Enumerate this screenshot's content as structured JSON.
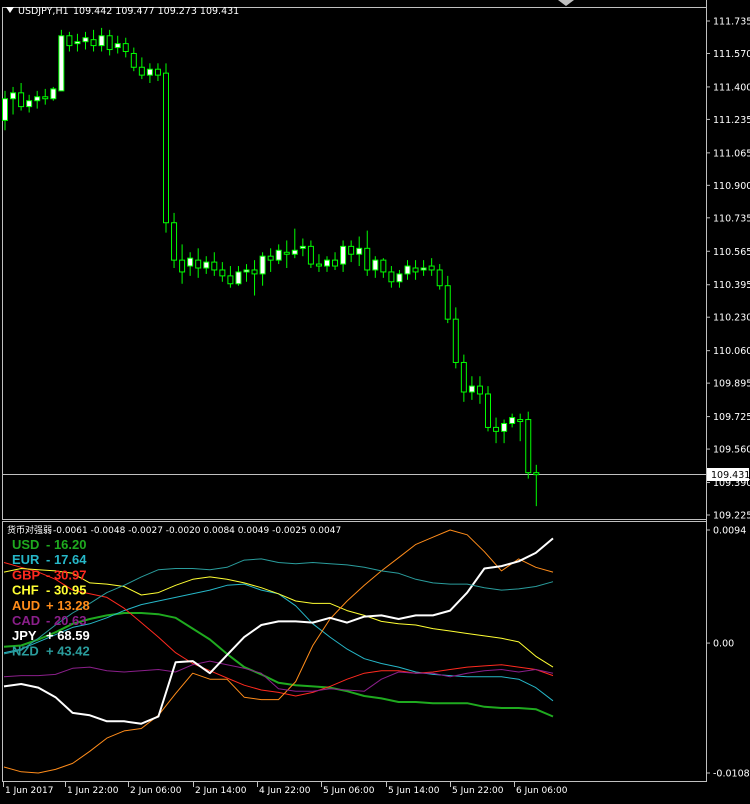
{
  "header": {
    "symbol_tf": "USDJPY,H1",
    "ohlc": "109.442 109.477 109.273 109.431"
  },
  "indicator": {
    "name": "货币对强弱",
    "values": "-0.0061 -0.0048 -0.0027 -0.0020 0.0084 0.0049 -0.0025 0.0047"
  },
  "current_price": "109.431",
  "colors": {
    "background": "#000000",
    "candle": "#00ff00",
    "bull_body": "#ffffff",
    "grid_frame": "#c0c0c0",
    "USD": "#1faa1f",
    "EUR": "#26b7c8",
    "GBP": "#ff2a1f",
    "CHF": "#ffff33",
    "AUD": "#ff8c1a",
    "CAD": "#8b1f8b",
    "JPY": "#ffffff",
    "NZD": "#2a9d9d"
  },
  "chart_data": [
    {
      "type": "candlestick",
      "title": "USDJPY,H1",
      "y_ticks": [
        "111.735",
        "111.570",
        "111.400",
        "111.235",
        "111.065",
        "110.900",
        "110.735",
        "110.565",
        "110.395",
        "110.230",
        "110.060",
        "109.895",
        "109.725",
        "109.560",
        "109.390",
        "109.225"
      ],
      "ylim": [
        109.225,
        111.735
      ],
      "x_ticks": [
        "1 Jun 2017",
        "1 Jun 22:00",
        "2 Jun 06:00",
        "2 Jun 14:00",
        "4 Jun 22:00",
        "5 Jun 06:00",
        "5 Jun 14:00",
        "5 Jun 22:00",
        "6 Jun 06:00"
      ],
      "candles": [
        [
          111.23,
          111.38,
          111.18,
          111.34
        ],
        [
          111.34,
          111.4,
          111.26,
          111.37
        ],
        [
          111.37,
          111.42,
          111.28,
          111.3
        ],
        [
          111.3,
          111.36,
          111.27,
          111.33
        ],
        [
          111.33,
          111.38,
          111.29,
          111.35
        ],
        [
          111.35,
          111.39,
          111.31,
          111.34
        ],
        [
          111.34,
          111.4,
          111.33,
          111.39
        ],
        [
          111.38,
          111.69,
          111.38,
          111.66
        ],
        [
          111.66,
          111.68,
          111.58,
          111.61
        ],
        [
          111.62,
          111.67,
          111.58,
          111.63
        ],
        [
          111.63,
          111.68,
          111.59,
          111.65
        ],
        [
          111.64,
          111.69,
          111.58,
          111.61
        ],
        [
          111.61,
          111.7,
          111.58,
          111.66
        ],
        [
          111.66,
          111.69,
          111.56,
          111.59
        ],
        [
          111.6,
          111.66,
          111.57,
          111.62
        ],
        [
          111.62,
          111.65,
          111.55,
          111.58
        ],
        [
          111.57,
          111.6,
          111.48,
          111.5
        ],
        [
          111.5,
          111.55,
          111.44,
          111.46
        ],
        [
          111.46,
          111.52,
          111.42,
          111.49
        ],
        [
          111.49,
          111.52,
          111.43,
          111.46
        ],
        [
          111.47,
          111.52,
          110.66,
          110.71
        ],
        [
          110.71,
          110.76,
          110.48,
          110.52
        ],
        [
          110.52,
          110.6,
          110.4,
          110.46
        ],
        [
          110.49,
          110.56,
          110.44,
          110.53
        ],
        [
          110.52,
          110.58,
          110.43,
          110.48
        ],
        [
          110.48,
          110.54,
          110.45,
          110.51
        ],
        [
          110.51,
          110.56,
          110.44,
          110.47
        ],
        [
          110.47,
          110.51,
          110.41,
          110.44
        ],
        [
          110.44,
          110.49,
          110.38,
          110.4
        ],
        [
          110.4,
          110.49,
          110.39,
          110.46
        ],
        [
          110.46,
          110.5,
          110.41,
          110.47
        ],
        [
          110.47,
          110.52,
          110.34,
          110.45
        ],
        [
          110.45,
          110.56,
          110.39,
          110.54
        ],
        [
          110.54,
          110.58,
          110.46,
          110.52
        ],
        [
          110.52,
          110.6,
          110.5,
          110.57
        ],
        [
          110.56,
          110.62,
          110.48,
          110.55
        ],
        [
          110.55,
          110.68,
          110.53,
          110.57
        ],
        [
          110.58,
          110.63,
          110.54,
          110.59
        ],
        [
          110.59,
          110.62,
          110.48,
          110.5
        ],
        [
          110.5,
          110.55,
          110.46,
          110.49
        ],
        [
          110.49,
          110.54,
          110.46,
          110.52
        ],
        [
          110.52,
          110.56,
          110.47,
          110.49
        ],
        [
          110.5,
          110.62,
          110.46,
          110.59
        ],
        [
          110.59,
          110.62,
          110.51,
          110.55
        ],
        [
          110.55,
          110.64,
          110.49,
          110.58
        ],
        [
          110.58,
          110.67,
          110.44,
          110.47
        ],
        [
          110.47,
          110.54,
          110.43,
          110.52
        ],
        [
          110.52,
          110.53,
          110.43,
          110.46
        ],
        [
          110.46,
          110.49,
          110.38,
          110.41
        ],
        [
          110.41,
          110.47,
          110.38,
          110.45
        ],
        [
          110.45,
          110.52,
          110.42,
          110.49
        ],
        [
          110.48,
          110.52,
          110.42,
          110.46
        ],
        [
          110.47,
          110.52,
          110.44,
          110.48
        ],
        [
          110.49,
          110.53,
          110.44,
          110.47
        ],
        [
          110.47,
          110.5,
          110.37,
          110.39
        ],
        [
          110.39,
          110.44,
          110.2,
          110.22
        ],
        [
          110.22,
          110.28,
          109.97,
          110.0
        ],
        [
          110.0,
          110.04,
          109.8,
          109.85
        ],
        [
          109.85,
          109.93,
          109.81,
          109.88
        ],
        [
          109.88,
          109.93,
          109.79,
          109.84
        ],
        [
          109.84,
          109.88,
          109.65,
          109.67
        ],
        [
          109.67,
          109.72,
          109.59,
          109.65
        ],
        [
          109.65,
          109.71,
          109.59,
          109.69
        ],
        [
          109.69,
          109.74,
          109.67,
          109.72
        ],
        [
          109.71,
          109.74,
          109.6,
          109.7
        ],
        [
          109.71,
          109.75,
          109.41,
          109.44
        ],
        [
          109.44,
          109.48,
          109.27,
          109.43
        ]
      ]
    },
    {
      "type": "line",
      "title": "货币对强弱",
      "y_ticks": [
        "0.0094",
        "0.00",
        "-0.0108"
      ],
      "ylim": [
        -0.0108,
        0.0094
      ],
      "series": [
        {
          "name": "USD",
          "value": "-16.20",
          "sign": "-",
          "values": [
            -0.0003,
            -0.0002,
            0.0003,
            0.0009,
            0.0016,
            0.002,
            0.0023,
            0.0025,
            0.0025,
            0.0024,
            0.0021,
            0.0012,
            0.0003,
            -0.0009,
            -0.002,
            -0.0026,
            -0.0033,
            -0.0035,
            -0.0036,
            -0.0037,
            -0.004,
            -0.0044,
            -0.0046,
            -0.0049,
            -0.0049,
            -0.005,
            -0.005,
            -0.005,
            -0.0053,
            -0.0054,
            -0.0054,
            -0.0055,
            -0.0061
          ]
        },
        {
          "name": "EUR",
          "value": "-17.64",
          "sign": "-",
          "values": [
            -0.0008,
            -0.0005,
            0.0001,
            0.0007,
            0.0013,
            0.0016,
            0.0021,
            0.0027,
            0.0032,
            0.0035,
            0.0038,
            0.0041,
            0.0044,
            0.0048,
            0.0049,
            0.0044,
            0.0041,
            0.0031,
            0.0016,
            0.0005,
            -0.0005,
            -0.0013,
            -0.0017,
            -0.002,
            -0.0024,
            -0.0026,
            -0.0027,
            -0.0028,
            -0.0028,
            -0.0028,
            -0.003,
            -0.0037,
            -0.0048
          ]
        },
        {
          "name": "GBP",
          "value": "-30.97",
          "sign": "-",
          "values": [
            0.0067,
            0.0063,
            0.0059,
            0.0053,
            0.0044,
            0.0041,
            0.0038,
            0.0029,
            0.0017,
            0.0005,
            -0.0008,
            -0.0017,
            -0.0023,
            -0.0029,
            -0.0035,
            -0.0039,
            -0.0041,
            -0.0044,
            -0.0041,
            -0.0036,
            -0.003,
            -0.0025,
            -0.0023,
            -0.0023,
            -0.0025,
            -0.0024,
            -0.0022,
            -0.002,
            -0.0019,
            -0.0018,
            -0.002,
            -0.0022,
            -0.0027
          ]
        },
        {
          "name": "CHF",
          "value": "-30.95",
          "sign": "-",
          "values": [
            0.0059,
            0.0062,
            0.0061,
            0.006,
            0.0058,
            0.005,
            0.0049,
            0.0047,
            0.004,
            0.0042,
            0.0048,
            0.0053,
            0.0055,
            0.0053,
            0.005,
            0.0046,
            0.0041,
            0.0035,
            0.0033,
            0.0033,
            0.0027,
            0.0023,
            0.0018,
            0.0016,
            0.0015,
            0.0012,
            0.001,
            0.0008,
            0.0006,
            0.0004,
            0.0001,
            -0.0011,
            -0.002
          ]
        },
        {
          "name": "AUD",
          "value": "+ 13.28",
          "sign": "+",
          "values": [
            -0.0103,
            -0.0107,
            -0.0108,
            -0.0105,
            -0.01,
            -0.009,
            -0.0079,
            -0.0073,
            -0.0071,
            -0.006,
            -0.0042,
            -0.0025,
            -0.003,
            -0.003,
            -0.0045,
            -0.0047,
            -0.0047,
            -0.0032,
            -0.0002,
            0.002,
            0.0035,
            0.0048,
            0.006,
            0.0071,
            0.0082,
            0.0088,
            0.0094,
            0.009,
            0.0076,
            0.006,
            0.007,
            0.0063,
            0.0059
          ]
        },
        {
          "name": "CAD",
          "value": "-20.63",
          "sign": "-",
          "values": [
            -0.0028,
            -0.0027,
            -0.0027,
            -0.0026,
            -0.0021,
            -0.002,
            -0.0023,
            -0.0024,
            -0.0023,
            -0.0022,
            -0.0024,
            -0.0018,
            -0.0015,
            -0.0018,
            -0.0021,
            -0.0025,
            -0.0038,
            -0.004,
            -0.004,
            -0.0038,
            -0.0039,
            -0.004,
            -0.003,
            -0.0024,
            -0.0025,
            -0.0025,
            -0.0028,
            -0.0025,
            -0.0023,
            -0.0022,
            -0.0024,
            -0.0022,
            -0.0025
          ]
        },
        {
          "name": "JPY",
          "value": "+ 68.59",
          "sign": "+",
          "values": [
            -0.0036,
            -0.0034,
            -0.0037,
            -0.0045,
            -0.0058,
            -0.006,
            -0.0065,
            -0.0065,
            -0.0067,
            -0.0061,
            -0.0016,
            -0.0015,
            -0.0025,
            -0.001,
            0.0005,
            0.0015,
            0.0018,
            0.0018,
            0.0017,
            0.0021,
            0.0017,
            0.0022,
            0.0023,
            0.002,
            0.0023,
            0.0023,
            0.0027,
            0.0042,
            0.0062,
            0.0064,
            0.0068,
            0.0075,
            0.0087
          ]
        },
        {
          "name": "NZD",
          "value": "+ 43.42",
          "sign": "+",
          "values": [
            -0.0009,
            -0.0006,
            0.0004,
            0.0015,
            0.0025,
            0.0033,
            0.0042,
            0.0048,
            0.0055,
            0.0061,
            0.0062,
            0.0062,
            0.0061,
            0.0063,
            0.0069,
            0.007,
            0.0067,
            0.0066,
            0.0067,
            0.0066,
            0.0065,
            0.0063,
            0.006,
            0.0058,
            0.0053,
            0.005,
            0.0049,
            0.0049,
            0.0046,
            0.0044,
            0.0045,
            0.0047,
            0.0051
          ]
        }
      ]
    }
  ]
}
